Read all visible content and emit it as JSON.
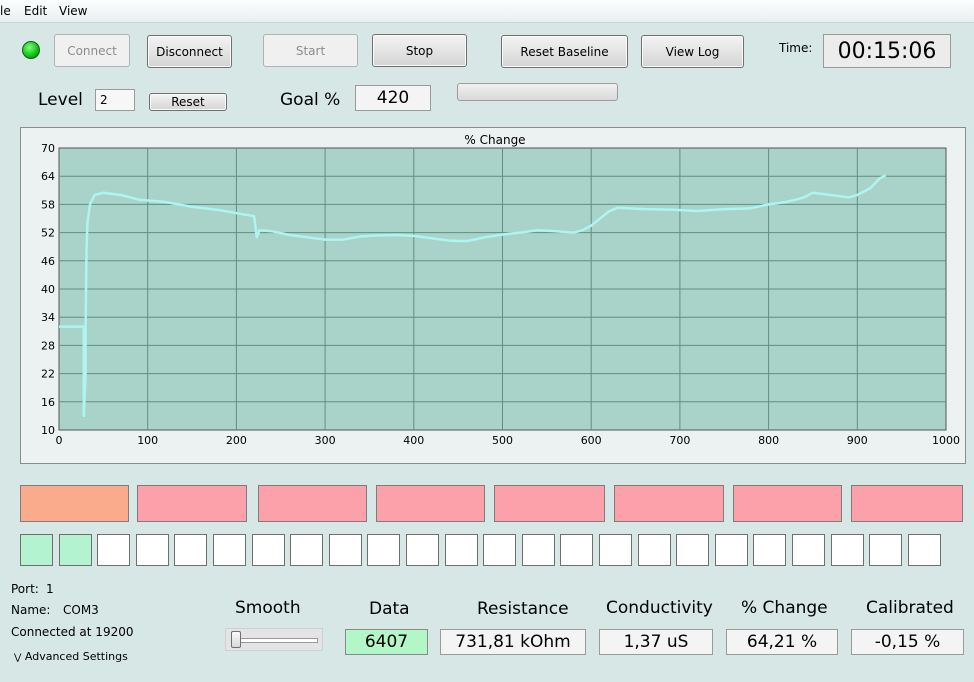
{
  "menu": {
    "items": [
      "le",
      "Edit",
      "View"
    ]
  },
  "status_led": {
    "color": "#19c519",
    "state": "connected"
  },
  "toolbar": {
    "connect_label": "Connect",
    "disconnect_label": "Disconnect",
    "start_label": "Start",
    "stop_label": "Stop",
    "reset_baseline_label": "Reset Baseline",
    "view_log_label": "View Log"
  },
  "time": {
    "label": "Time:",
    "value": "00:15:06"
  },
  "level": {
    "label": "Level",
    "value": "2",
    "reset_label": "Reset"
  },
  "goal": {
    "label": "Goal %",
    "value": "420"
  },
  "progress": {
    "fraction": 0.0
  },
  "chart_data": {
    "type": "line",
    "title": "% Change",
    "xlabel": "",
    "ylabel": "",
    "xlim": [
      0,
      1000
    ],
    "ylim": [
      10,
      70
    ],
    "x_ticks": [
      0,
      100,
      200,
      300,
      400,
      500,
      600,
      700,
      800,
      900,
      1000
    ],
    "y_ticks": [
      10,
      16,
      22,
      28,
      34,
      40,
      46,
      52,
      58,
      64,
      70
    ],
    "grid": true,
    "colors": {
      "background": "#a9d3c8",
      "line": "#aef4f0",
      "grid": "#5f8f80"
    },
    "series": [
      {
        "values": [
          [
            0,
            32
          ],
          [
            28,
            32
          ],
          [
            28,
            13
          ],
          [
            30,
            22
          ],
          [
            30,
            32
          ],
          [
            31,
            48
          ],
          [
            32,
            54
          ],
          [
            35,
            58
          ],
          [
            40,
            60
          ],
          [
            50,
            60.5
          ],
          [
            70,
            60
          ],
          [
            90,
            59
          ],
          [
            120,
            58.5
          ],
          [
            150,
            57.5
          ],
          [
            180,
            56.8
          ],
          [
            210,
            55.8
          ],
          [
            220,
            55.5
          ],
          [
            223,
            51
          ],
          [
            226,
            52.5
          ],
          [
            240,
            52.3
          ],
          [
            260,
            51.5
          ],
          [
            280,
            51
          ],
          [
            300,
            50.5
          ],
          [
            320,
            50.5
          ],
          [
            340,
            51.2
          ],
          [
            360,
            51.4
          ],
          [
            380,
            51.5
          ],
          [
            400,
            51.3
          ],
          [
            420,
            50.8
          ],
          [
            440,
            50.3
          ],
          [
            460,
            50.2
          ],
          [
            480,
            51
          ],
          [
            500,
            51.6
          ],
          [
            520,
            52
          ],
          [
            540,
            52.5
          ],
          [
            560,
            52.3
          ],
          [
            580,
            52
          ],
          [
            590,
            52.5
          ],
          [
            600,
            53.5
          ],
          [
            610,
            55
          ],
          [
            620,
            56.5
          ],
          [
            630,
            57.3
          ],
          [
            660,
            57
          ],
          [
            690,
            56.9
          ],
          [
            720,
            56.6
          ],
          [
            750,
            57
          ],
          [
            780,
            57.2
          ],
          [
            800,
            58
          ],
          [
            820,
            58.5
          ],
          [
            840,
            59.5
          ],
          [
            850,
            60.5
          ],
          [
            870,
            60
          ],
          [
            890,
            59.5
          ],
          [
            900,
            60
          ],
          [
            915,
            61.5
          ],
          [
            925,
            63.5
          ],
          [
            932,
            64.2
          ]
        ]
      }
    ]
  },
  "indicators": {
    "row1": [
      {
        "color": "#f9ab8c"
      },
      {
        "color": "#fca0aa"
      },
      {
        "color": "#fca0aa"
      },
      {
        "color": "#fca0aa"
      },
      {
        "color": "#fca0aa"
      },
      {
        "color": "#fca0aa"
      },
      {
        "color": "#fca0aa"
      },
      {
        "color": "#fca0aa"
      }
    ],
    "row2_count": 24,
    "row2_active": 2
  },
  "port": {
    "port_label": "Port:",
    "port_value": "1",
    "name_label": "Name:",
    "name_value": "COM3",
    "connected_text": "Connected at 19200",
    "advanced_label": "Advanced Settings"
  },
  "smooth": {
    "label": "Smooth",
    "level": 0.0
  },
  "readouts": {
    "data": {
      "label": "Data",
      "value": "6407"
    },
    "resistance": {
      "label": "Resistance",
      "value": "731,81 kOhm"
    },
    "conductivity": {
      "label": "Conductivity",
      "value": "1,37 uS"
    },
    "change": {
      "label": "% Change",
      "value": "64,21 %"
    },
    "calibrated": {
      "label": "Calibrated",
      "value": "-0,15 %"
    }
  }
}
